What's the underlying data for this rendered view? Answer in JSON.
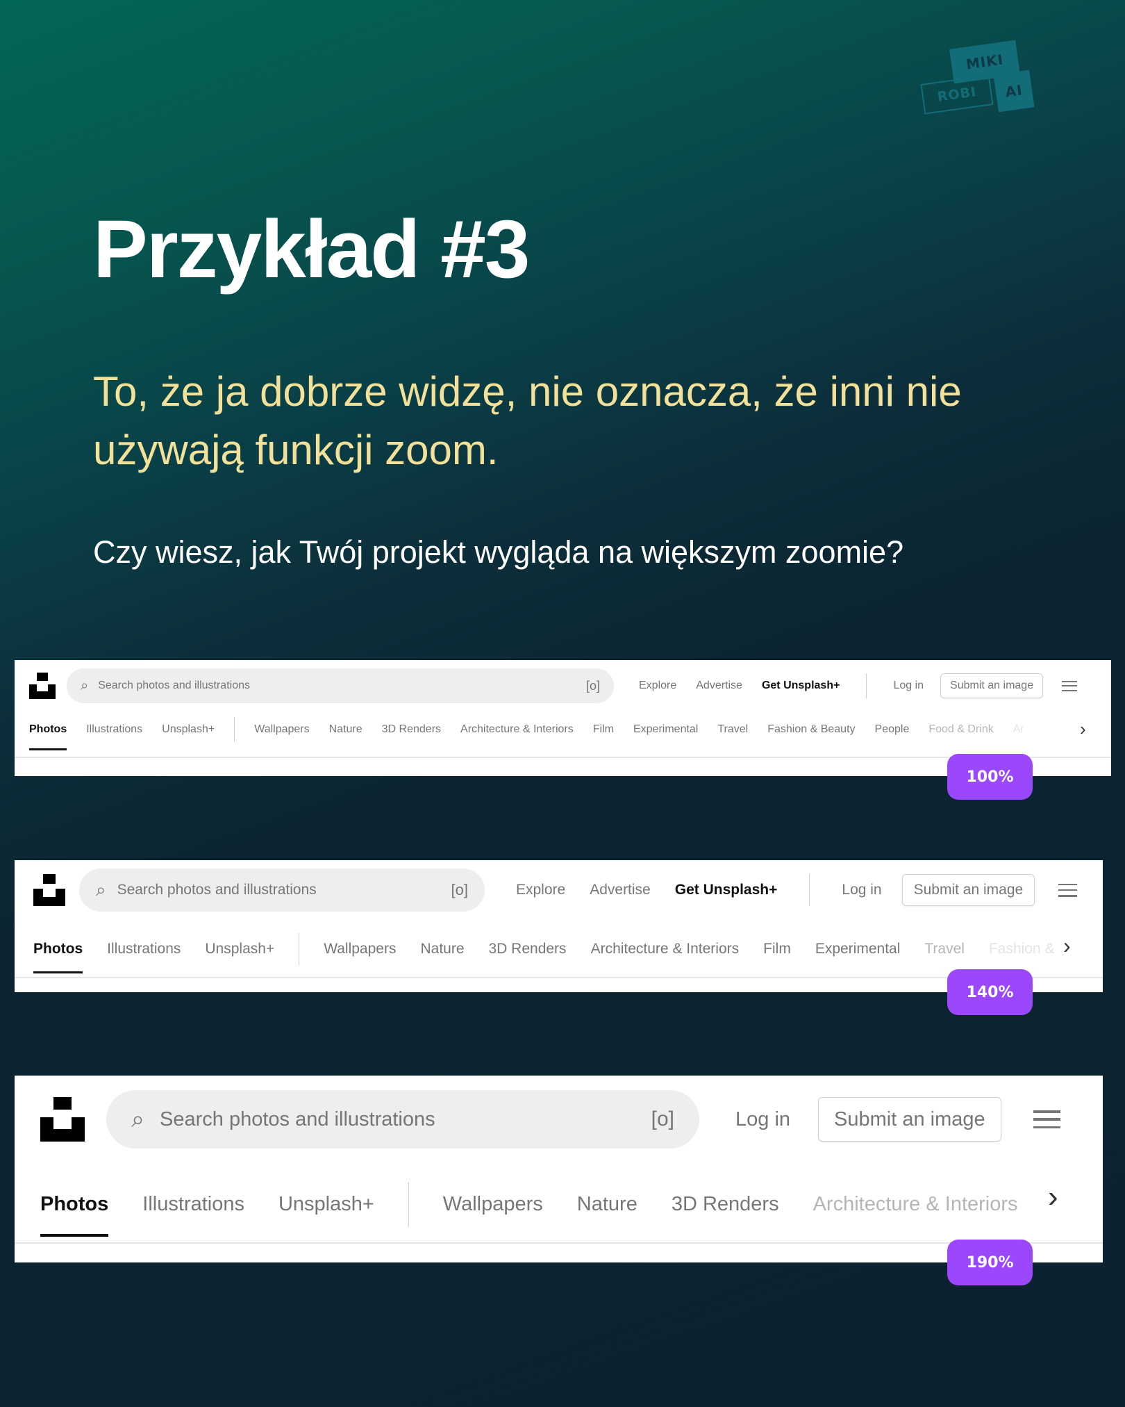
{
  "brand": {
    "line1": "MIKI",
    "line2": "ROBI",
    "line3": "AI"
  },
  "title": "Przykład #3",
  "subtitle": "To, że ja dobrze widzę, nie oznacza, że inni nie używają funkcji zoom.",
  "question": "Czy wiesz, jak Twój projekt wygląda na większym zoomie?",
  "colors": {
    "badge": "#9b47fb",
    "subtitle": "#f3e19a",
    "bg_top": "#046656",
    "bg_bottom": "#0c2230"
  },
  "screens": [
    {
      "zoom_label": "100%",
      "search_placeholder": "Search photos and illustrations",
      "nav": [
        "Explore",
        "Advertise",
        "Get Unsplash+"
      ],
      "login": "Log in",
      "submit": "Submit an image",
      "categories": [
        "Photos",
        "Illustrations",
        "Unsplash+",
        "Wallpapers",
        "Nature",
        "3D Renders",
        "Architecture & Interiors",
        "Film",
        "Experimental",
        "Travel",
        "Fashion & Beauty",
        "People",
        "Food & Drink",
        "Ar"
      ]
    },
    {
      "zoom_label": "140%",
      "search_placeholder": "Search photos and illustrations",
      "nav": [
        "Explore",
        "Advertise",
        "Get Unsplash+"
      ],
      "login": "Log in",
      "submit": "Submit an image",
      "categories": [
        "Photos",
        "Illustrations",
        "Unsplash+",
        "Wallpapers",
        "Nature",
        "3D Renders",
        "Architecture & Interiors",
        "Film",
        "Experimental",
        "Travel",
        "Fashion &"
      ]
    },
    {
      "zoom_label": "190%",
      "search_placeholder": "Search photos and illustrations",
      "login": "Log in",
      "submit": "Submit an image",
      "categories": [
        "Photos",
        "Illustrations",
        "Unsplash+",
        "Wallpapers",
        "Nature",
        "3D Renders",
        "Architecture & Interiors"
      ]
    }
  ]
}
